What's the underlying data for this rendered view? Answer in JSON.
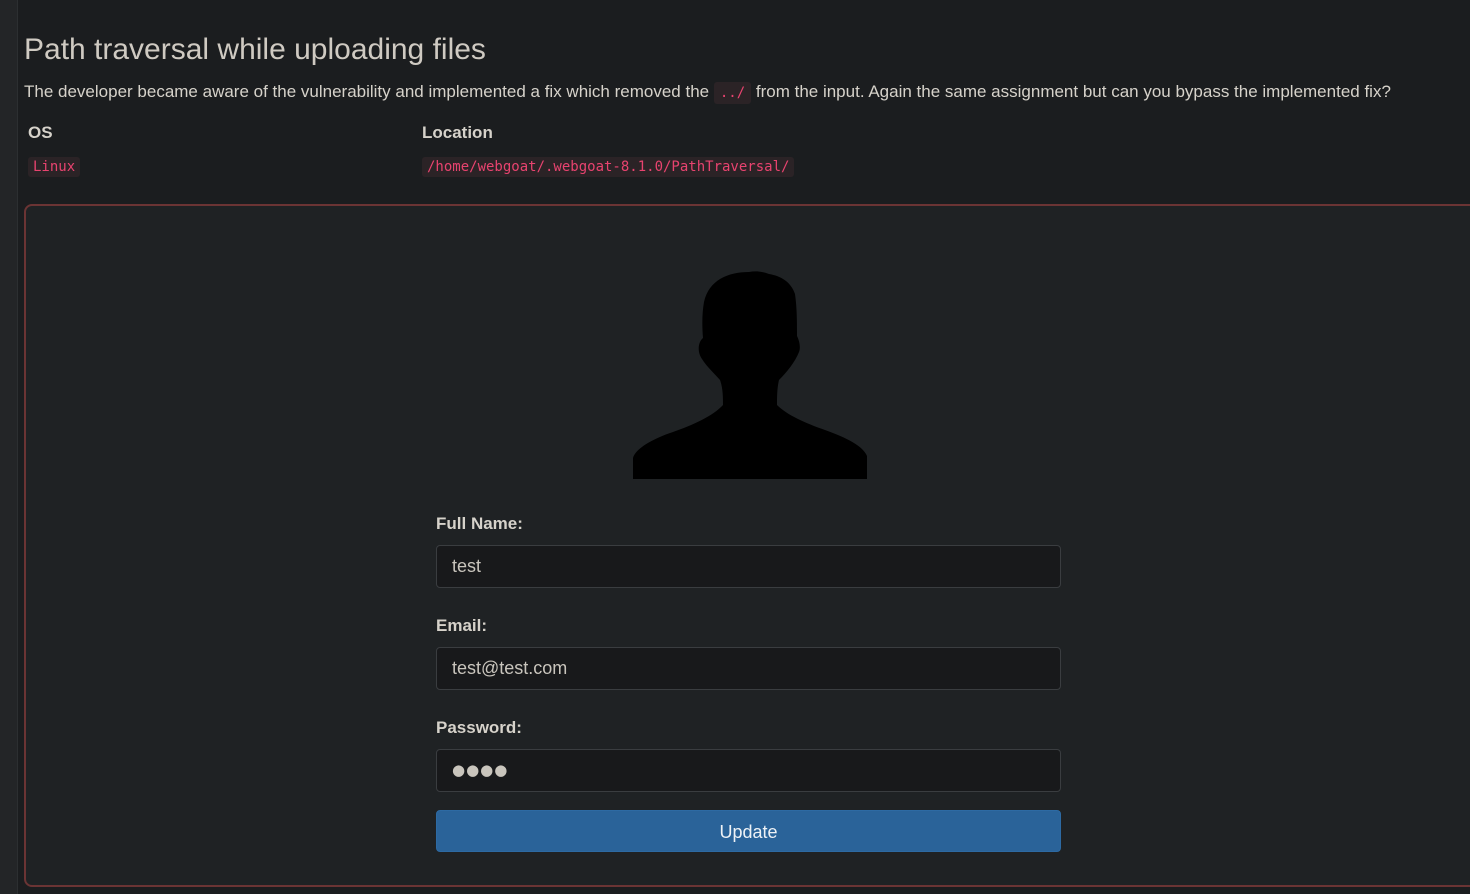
{
  "page": {
    "title": "Path traversal while uploading files",
    "intro_before": "The developer became aware of the vulnerability and implemented a fix which removed the",
    "intro_code": "../",
    "intro_after": "from the input. Again the same assignment but can you bypass the implemented fix?"
  },
  "env_table": {
    "headers": [
      "OS",
      "Location"
    ],
    "row": {
      "os": "Linux",
      "location": "/home/webgoat/.webgoat-8.1.0/PathTraversal/"
    }
  },
  "profile_form": {
    "avatar_icon": "user-silhouette-icon",
    "full_name": {
      "label": "Full Name:",
      "value": "test"
    },
    "email": {
      "label": "Email:",
      "value": "test@test.com"
    },
    "password": {
      "label": "Password:",
      "value": "●●●●"
    },
    "update_label": "Update"
  },
  "colors": {
    "background": "#1b1d1f",
    "panel_border": "#6b3434",
    "code_text": "#e8436f",
    "button": "#2a6399"
  }
}
